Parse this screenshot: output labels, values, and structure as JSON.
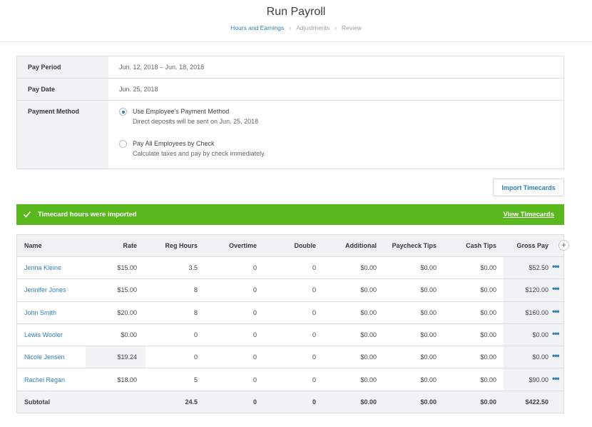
{
  "header": {
    "title": "Run Payroll",
    "steps": [
      "Hours and Earnings",
      "Adjustments",
      "Review"
    ]
  },
  "info": {
    "pay_period_label": "Pay Period",
    "pay_period_value": "Jun. 12, 2018 – Jun. 18, 2018",
    "pay_date_label": "Pay Date",
    "pay_date_value": "Jun. 25, 2018",
    "payment_method_label": "Payment Method",
    "options": [
      {
        "title": "Use Employee's Payment Method",
        "subtitle": "Direct deposits will be sent on Jun. 25, 2018",
        "selected": true
      },
      {
        "title": "Pay All Employees by Check",
        "subtitle": "Calculate taxes and pay by check immediately.",
        "selected": false
      }
    ]
  },
  "import_button": "Import Timecards",
  "banner": {
    "message": "Timecard hours were imported",
    "link": "View Timecards",
    "color": "#5ab81f"
  },
  "table": {
    "headers": [
      "Name",
      "Rate",
      "Reg Hours",
      "Overtime",
      "Double",
      "Additional",
      "Paycheck Tips",
      "Cash Tips",
      "Gross Pay"
    ],
    "rows": [
      [
        "Jenna Kleine",
        "$15.00",
        "3.5",
        "0",
        "0",
        "$0.00",
        "$0.00",
        "$0.00",
        "$52.50"
      ],
      [
        "Jennifer Jones",
        "$15.00",
        "8",
        "0",
        "0",
        "$0.00",
        "$0.00",
        "$0.00",
        "$120.00"
      ],
      [
        "John Smith",
        "$20.00",
        "8",
        "0",
        "0",
        "$0.00",
        "$0.00",
        "$0.00",
        "$160.00"
      ],
      [
        "Lewis Wooler",
        "$0.00",
        "0",
        "0",
        "0",
        "$0.00",
        "$0.00",
        "$0.00",
        "$0.00"
      ],
      [
        "Nicole Jensen",
        "$19.24",
        "0",
        "0",
        "0",
        "$0.00",
        "$0.00",
        "$0.00",
        "$0.00"
      ],
      [
        "Rachel Regan",
        "$18.00",
        "5",
        "0",
        "0",
        "$0.00",
        "$0.00",
        "$0.00",
        "$90.00"
      ]
    ],
    "subtotal": [
      "Subtotal",
      "",
      "24.5",
      "0",
      "0",
      "$0.00",
      "$0.00",
      "$0.00",
      "$422.50"
    ]
  },
  "colors": {
    "accent": "#2f7fb6",
    "panel_bg": "#f1f2f3"
  }
}
